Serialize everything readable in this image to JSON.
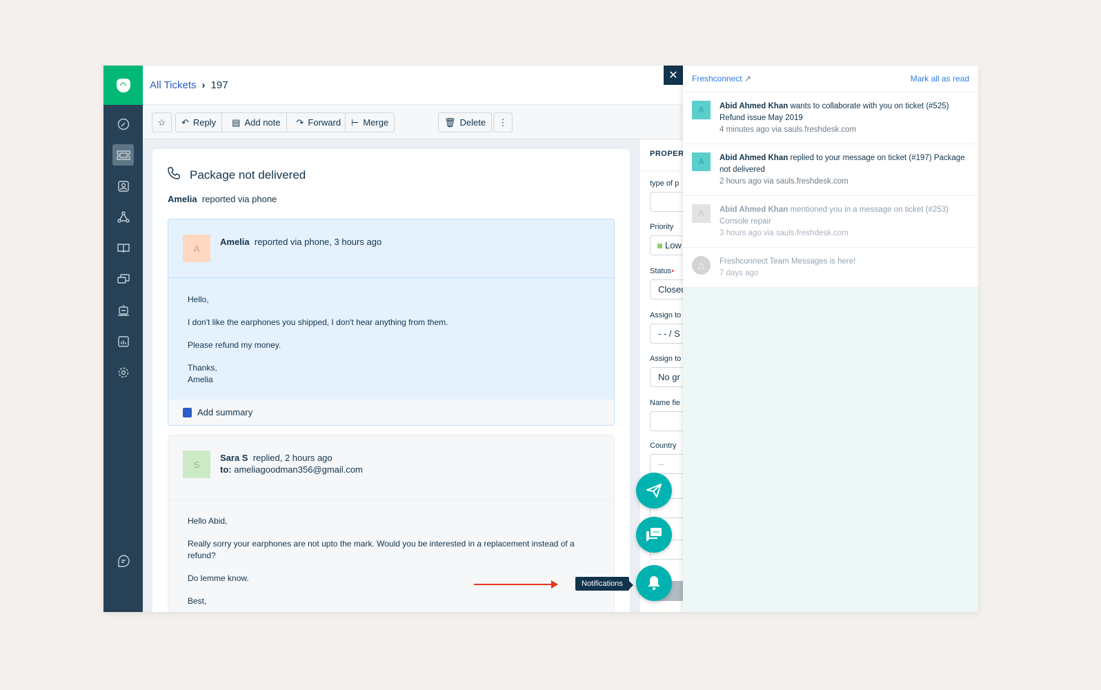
{
  "breadcrumb": {
    "parent": "All Tickets",
    "current": "197"
  },
  "toolbar": {
    "reply": "Reply",
    "add_note": "Add note",
    "forward": "Forward",
    "merge": "Merge",
    "delete": "Delete"
  },
  "ticket": {
    "subject": "Package not delivered",
    "requester": "Amelia",
    "via": "reported via phone"
  },
  "messages": [
    {
      "avatar": "A",
      "author": "Amelia",
      "meta": "reported via phone, 3 hours ago",
      "body": [
        "Hello,",
        "I don't like the earphones you shipped, I don't hear anything from them.",
        "Please refund my money."
      ],
      "signoff": "Thanks,",
      "signature": "Amelia",
      "summary": "Add summary"
    },
    {
      "avatar": "S",
      "author": "Sara S",
      "meta": "replied, 2 hours ago",
      "to_label": "to:",
      "to": "ameliagoodman356@gmail.com",
      "body": [
        "Hello Abid,",
        "Really sorry your earphones are not upto the mark. Would you be interested in a replacement instead of a refund?",
        "Do lemme know."
      ],
      "signoff": "Best,"
    }
  ],
  "properties": {
    "heading": "PROPERT",
    "fields": [
      {
        "label": "type of p",
        "value": ""
      },
      {
        "label": "Priority",
        "value": "Low"
      },
      {
        "label": "Status",
        "value": "Closed",
        "required": true
      },
      {
        "label": "Assign to",
        "value": "- - / S"
      },
      {
        "label": "Assign to",
        "value": "No gr"
      },
      {
        "label": "Name fie",
        "value": ""
      },
      {
        "label": "Country",
        "value": "--"
      }
    ]
  },
  "notifications_panel": {
    "title": "Freshconnect",
    "mark_all": "Mark all as read",
    "items": [
      {
        "avatar": "A",
        "actor": "Abid Ahmed Khan",
        "text": " wants to collaborate with you on ticket (#525) Refund issue May 2019",
        "meta": "4 minutes ago via sauls.freshdesk.com",
        "read": false
      },
      {
        "avatar": "A",
        "actor": "Abid Ahmed Khan",
        "text": " replied to your message on ticket (#197) Package not delivered",
        "meta": "2 hours ago via sauls.freshdesk.com",
        "read": false
      },
      {
        "avatar": "A",
        "actor": "Abid Ahmed Khan",
        "text": " mentioned you in a message on ticket (#253) Console repair",
        "meta": "3 hours ago via sauls.freshdesk.com",
        "read": true
      },
      {
        "avatar": "",
        "actor": "",
        "text": "Freshconnect Team Messages is here!",
        "meta": "7 days ago",
        "read": true
      }
    ]
  },
  "tooltip": "Notifications",
  "colors": {
    "brand": "#02b875",
    "sidebar": "#274256",
    "accent": "#00b3b0",
    "link": "#2c5cc5",
    "arrow": "#e8361b"
  }
}
